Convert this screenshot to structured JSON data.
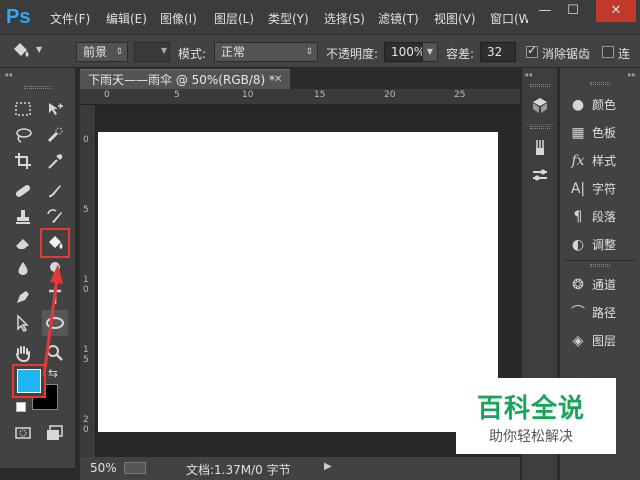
{
  "app": {
    "logo": "Ps"
  },
  "menu": {
    "items": [
      "文件(F)",
      "编辑(E)",
      "图像(I)",
      "图层(L)",
      "类型(Y)",
      "选择(S)",
      "滤镜(T)",
      "视图(V)",
      "窗口(W"
    ]
  },
  "window_controls": {
    "minimize": "—",
    "maximize": "☐",
    "close": "✕"
  },
  "options": {
    "fill_source": "前景",
    "mode_label": "模式:",
    "mode_value": "正常",
    "opacity_label": "不透明度:",
    "opacity_value": "100%",
    "tolerance_label": "容差:",
    "tolerance_value": "32",
    "antialias_label": "消除锯齿",
    "antialias_checked": true,
    "contiguous_label": "连"
  },
  "document": {
    "tab_title": "下雨天——雨伞 @ 50%(RGB/8) *",
    "close": "✕",
    "ruler_top": [
      "0",
      "5",
      "10",
      "15",
      "20",
      "25"
    ],
    "ruler_left": [
      "0",
      "5",
      "1\n0",
      "1\n5",
      "2\n0"
    ]
  },
  "colors": {
    "foreground": "#1eb6f4",
    "background": "#000000",
    "highlight": "#e53935",
    "canvas": "#ffffff"
  },
  "status": {
    "zoom": "50%",
    "doc_info": "文档:1.37M/0 字节"
  },
  "panels": {
    "group1": [
      {
        "icon": "palette-icon",
        "label": "颜色"
      },
      {
        "icon": "grid-icon",
        "label": "色板"
      },
      {
        "icon": "fx-icon",
        "label": "样式"
      },
      {
        "icon": "type-icon",
        "label": "字符"
      },
      {
        "icon": "pilcrow-icon",
        "label": "段落"
      },
      {
        "icon": "adjust-icon",
        "label": "调整"
      }
    ],
    "group2": [
      {
        "icon": "channels-icon",
        "label": "通道"
      },
      {
        "icon": "path-icon",
        "label": "路径"
      },
      {
        "icon": "layers-icon",
        "label": "图层"
      }
    ]
  },
  "watermark": {
    "title": "百科全说",
    "subtitle": "助你轻松解决"
  }
}
